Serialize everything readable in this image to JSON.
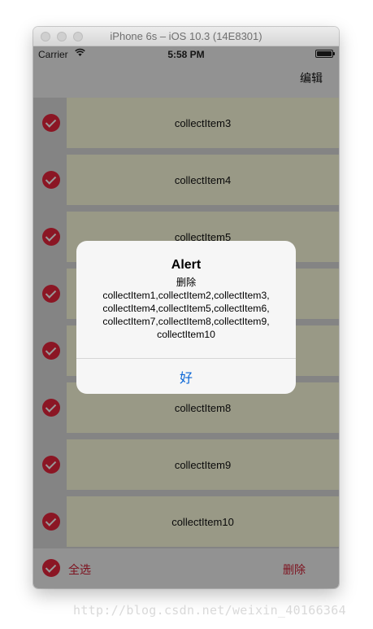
{
  "window": {
    "title": "iPhone 6s – iOS 10.3 (14E8301)"
  },
  "statusbar": {
    "carrier": "Carrier",
    "time": "5:58 PM"
  },
  "navbar": {
    "edit_label": "编辑"
  },
  "list": {
    "items": [
      {
        "label": "collectItem3",
        "checked": true
      },
      {
        "label": "collectItem4",
        "checked": true
      },
      {
        "label": "collectItem5",
        "checked": true
      },
      {
        "label": "collectItem6",
        "checked": true
      },
      {
        "label": "collectItem7",
        "checked": true
      },
      {
        "label": "collectItem8",
        "checked": true
      },
      {
        "label": "collectItem9",
        "checked": true
      },
      {
        "label": "collectItem10",
        "checked": true
      }
    ]
  },
  "bottombar": {
    "select_all_label": "全选",
    "delete_label": "删除"
  },
  "alert": {
    "title": "Alert",
    "message_line1": "删除",
    "message_line2": "collectItem1,collectItem2,collectItem3,",
    "message_line3": "collectItem4,collectItem5,collectItem6,",
    "message_line4": "collectItem7,collectItem8,collectItem9,",
    "message_line5": "collectItem10",
    "ok_label": "好"
  },
  "watermark": {
    "text": "http://blog.csdn.net/weixin_40166364"
  },
  "colors": {
    "accent_red": "#e8263d",
    "alert_button_blue": "#0a66d6",
    "cell_background": "#ffffe0"
  }
}
